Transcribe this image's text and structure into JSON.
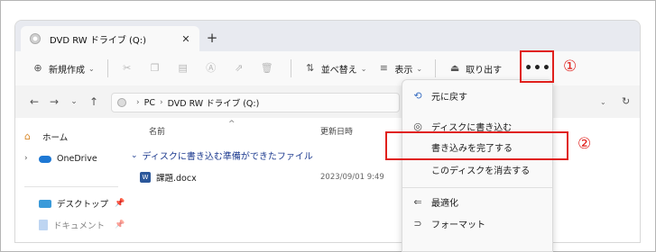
{
  "window": {
    "tab_title": "DVD RW ドライブ (Q:)",
    "tab_close": "✕",
    "new_tab": "+"
  },
  "toolbar": {
    "new_label": "新規作成",
    "sort_label": "並べ替え",
    "view_label": "表示",
    "eject_label": "取り出す",
    "more_label": "•••"
  },
  "nav": {
    "breadcrumb": [
      "PC",
      "DVD RW ドライブ (Q:)"
    ]
  },
  "sidebar": {
    "home": "ホーム",
    "onedrive": "OneDrive",
    "desktop": "デスクトップ",
    "documents": "ドキュメント"
  },
  "columns": {
    "name": "名前",
    "modified": "更新日時"
  },
  "group": {
    "label": "ディスクに書き込む準備ができたファイル"
  },
  "files": [
    {
      "name": "課題.docx",
      "date": "2023/09/01 9:49"
    }
  ],
  "menu": {
    "undo": "元に戻す",
    "burn": "ディスクに書き込む",
    "finish_burn": "書き込みを完了する",
    "erase_disc": "このディスクを消去する",
    "optimize": "最適化",
    "format": "フォーマット"
  },
  "annotations": {
    "callout_1": "①",
    "callout_2": "②"
  },
  "colors": {
    "annotation_red": "#e0201c",
    "link_blue": "#1c3a8f"
  }
}
